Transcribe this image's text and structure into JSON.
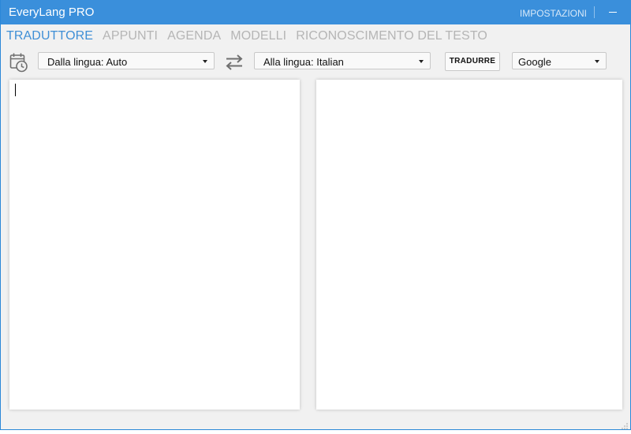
{
  "window": {
    "title": "EveryLang PRO",
    "settings_label": "IMPOSTAZIONI"
  },
  "tabs": [
    {
      "label": "TRADUTTORE",
      "active": true
    },
    {
      "label": "APPUNTI",
      "active": false
    },
    {
      "label": "AGENDA",
      "active": false
    },
    {
      "label": "MODELLI",
      "active": false
    },
    {
      "label": "RICONOSCIMENTO DEL TESTO",
      "active": false
    }
  ],
  "toolbar": {
    "from_language": "Dalla lingua: Auto",
    "to_language": "Alla lingua: Italian",
    "translate_label": "TRADURRE",
    "engine": "Google"
  },
  "editor": {
    "source_text": "",
    "target_text": ""
  },
  "colors": {
    "titlebar": "#3a8fdb",
    "active_tab": "#3f8fd6",
    "inactive_tab": "#b5b5b5",
    "background": "#f1f1f1"
  },
  "icons": {
    "history": "calendar-clock-icon",
    "swap": "swap-arrows-icon",
    "minimize": "minimize-icon",
    "dropdown": "caret-down-icon"
  }
}
